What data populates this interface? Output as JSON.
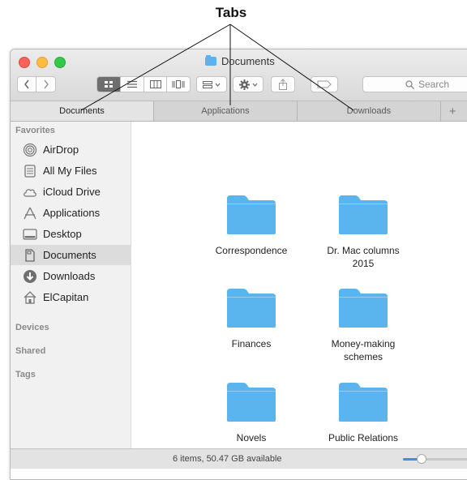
{
  "callout": {
    "title": "Tabs"
  },
  "window": {
    "title": "Documents"
  },
  "toolbar": {
    "back_icon": "chevron-left-icon",
    "forward_icon": "chevron-right-icon",
    "view_icons": [
      "icon-view-icon",
      "list-view-icon",
      "column-view-icon",
      "cover-flow-icon"
    ],
    "arrange_icon": "arrange-icon",
    "action_icon": "gear-icon",
    "share_icon": "share-icon",
    "tags_icon": "tag-icon",
    "search_placeholder": "Search",
    "search_icon": "magnifier-icon"
  },
  "tabs": [
    {
      "label": "Documents",
      "active": true
    },
    {
      "label": "Applications",
      "active": false
    },
    {
      "label": "Downloads",
      "active": false
    }
  ],
  "tab_add_label": "+",
  "sidebar": {
    "favorites_heading": "Favorites",
    "favorites": [
      {
        "label": "AirDrop",
        "icon": "airdrop-icon"
      },
      {
        "label": "All My Files",
        "icon": "all-files-icon"
      },
      {
        "label": "iCloud Drive",
        "icon": "cloud-icon"
      },
      {
        "label": "Applications",
        "icon": "applications-icon"
      },
      {
        "label": "Desktop",
        "icon": "desktop-icon"
      },
      {
        "label": "Documents",
        "icon": "document-icon",
        "selected": true
      },
      {
        "label": "Downloads",
        "icon": "download-icon"
      },
      {
        "label": "ElCapitan",
        "icon": "home-icon"
      }
    ],
    "devices_heading": "Devices",
    "shared_heading": "Shared",
    "tags_heading": "Tags"
  },
  "folders": [
    {
      "line1": "Correspondence",
      "line2": ""
    },
    {
      "line1": "Dr. Mac columns",
      "line2": "2015"
    },
    {
      "line1": "Finances",
      "line2": ""
    },
    {
      "line1": "Money-making",
      "line2": "schemes"
    },
    {
      "line1": "Novels",
      "line2": ""
    },
    {
      "line1": "Public Relations",
      "line2": ""
    }
  ],
  "colors": {
    "folder": "#5ab5ef",
    "accent": "#3b8fe6"
  },
  "status": {
    "text": "6 items, 50.47 GB available",
    "zoom_fraction": 0.25
  }
}
